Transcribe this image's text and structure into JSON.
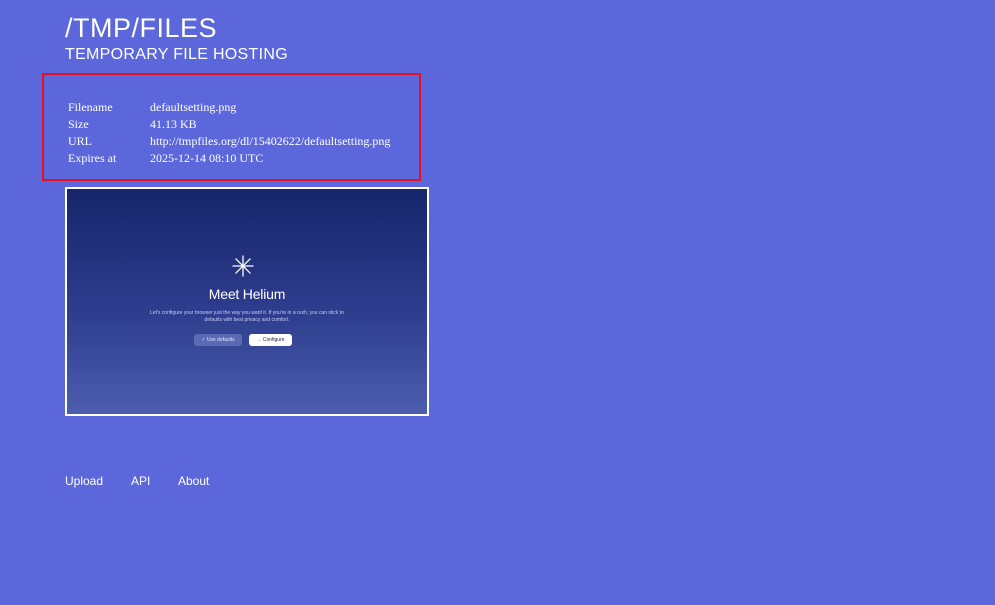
{
  "header": {
    "title": "/TMP/FILES",
    "subtitle": "TEMPORARY FILE HOSTING"
  },
  "file_info": {
    "rows": [
      {
        "label": "Filename",
        "value": "defaultsetting.png"
      },
      {
        "label": "Size",
        "value": "41.13 KB"
      },
      {
        "label": "URL",
        "value": "http://tmpfiles.org/dl/15402622/defaultsetting.png"
      },
      {
        "label": "Expires at",
        "value": "2025-12-14 08:10 UTC"
      }
    ]
  },
  "preview": {
    "heading": "Meet Helium",
    "text": "Let's configure your browser just the way you want it. If you're in a rush, you can stick to defaults with best privacy and comfort.",
    "defaults_button": "✓ Use defaults",
    "configure_button": "→ Configure",
    "icon": "asterisk-star-icon"
  },
  "nav": {
    "items": [
      {
        "label": "Upload"
      },
      {
        "label": "API"
      },
      {
        "label": "About"
      }
    ]
  },
  "colors": {
    "background": "#5b67db",
    "highlight_border": "#e51120",
    "text": "#ffffff"
  }
}
